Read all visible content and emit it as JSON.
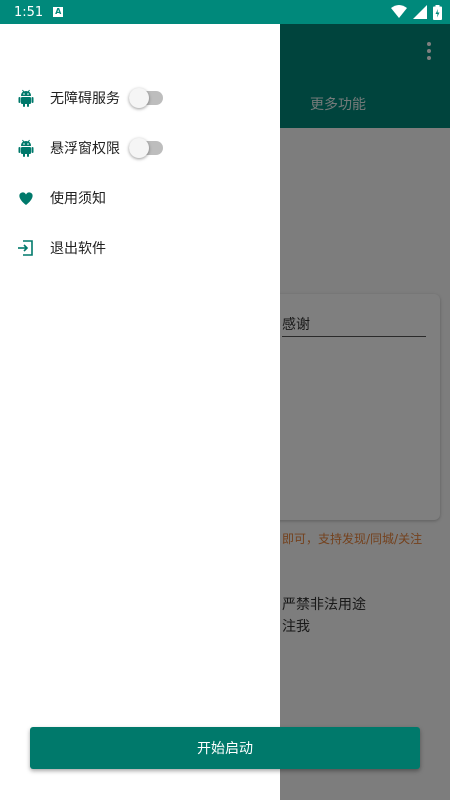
{
  "status_bar": {
    "time": "1:51",
    "notification_glyph": "A"
  },
  "background": {
    "tab_more": "更多功能",
    "card_input_value": "感谢",
    "hint_text": "即可，支持发现/同城/关注",
    "warning_line1": "严禁非法用途",
    "warning_line2": "注我"
  },
  "drawer": {
    "items": [
      {
        "label": "无障碍服务",
        "icon": "android-icon",
        "toggle": "off"
      },
      {
        "label": "悬浮窗权限",
        "icon": "android-icon",
        "toggle": "off"
      },
      {
        "label": "使用须知",
        "icon": "heart-icon"
      },
      {
        "label": "退出软件",
        "icon": "exit-icon"
      }
    ]
  },
  "start_button": {
    "label": "开始启动"
  },
  "colors": {
    "primary": "#00897b",
    "button": "#00796b",
    "hint": "#e8833a"
  }
}
